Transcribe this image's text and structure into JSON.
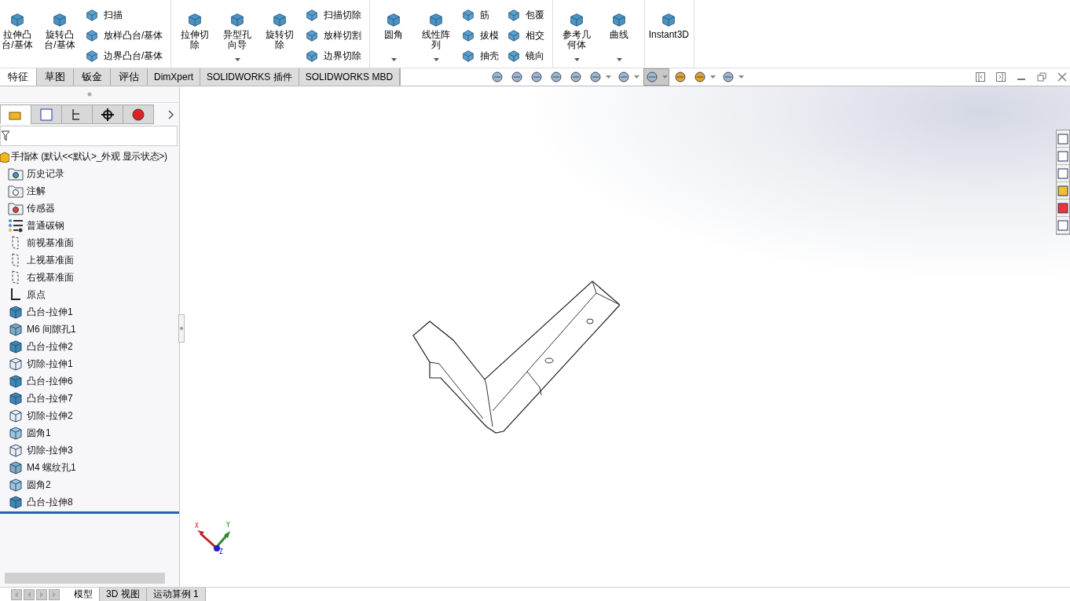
{
  "ribbon": {
    "groups": [
      {
        "items": [
          {
            "kind": "large",
            "label": "拉伸凸台/基体",
            "dropdown": false
          },
          {
            "kind": "large",
            "label": "旋转凸台/基体",
            "dropdown": false
          },
          {
            "kind": "stack",
            "entries": [
              "扫描",
              "放样凸台/基体",
              "边界凸台/基体"
            ]
          }
        ]
      },
      {
        "items": [
          {
            "kind": "large",
            "label": "拉伸切除",
            "dropdown": false
          },
          {
            "kind": "large",
            "label": "异型孔向导",
            "dropdown": true
          },
          {
            "kind": "large",
            "label": "旋转切除",
            "dropdown": false
          },
          {
            "kind": "stack",
            "entries": [
              "扫描切除",
              "放样切割",
              "边界切除"
            ]
          }
        ]
      },
      {
        "items": [
          {
            "kind": "large",
            "label": "圆角",
            "dropdown": true
          },
          {
            "kind": "large",
            "label": "线性阵列",
            "dropdown": true
          },
          {
            "kind": "stack",
            "entries": [
              "筋",
              "拔模",
              "抽壳"
            ]
          },
          {
            "kind": "stack",
            "entries": [
              "包覆",
              "相交",
              "镜向"
            ]
          }
        ]
      },
      {
        "items": [
          {
            "kind": "large",
            "label": "参考几何体",
            "dropdown": true
          },
          {
            "kind": "large",
            "label": "曲线",
            "dropdown": true
          }
        ]
      },
      {
        "items": [
          {
            "kind": "large",
            "label": "Instant3D",
            "dropdown": false
          }
        ]
      }
    ]
  },
  "tabs": [
    {
      "label": "特征",
      "selected": true
    },
    {
      "label": "草图",
      "selected": false
    },
    {
      "label": "钣金",
      "selected": false
    },
    {
      "label": "评估",
      "selected": false
    },
    {
      "label": "DimXpert",
      "selected": false
    },
    {
      "label": "SOLIDWORKS 插件",
      "selected": false
    },
    {
      "label": "SOLIDWORKS MBD",
      "selected": false
    }
  ],
  "view_toolbar": [
    {
      "dropdown": false,
      "pressed": false
    },
    {
      "dropdown": false,
      "pressed": false
    },
    {
      "dropdown": false,
      "pressed": false
    },
    {
      "dropdown": false,
      "pressed": false
    },
    {
      "dropdown": false,
      "pressed": false
    },
    {
      "dropdown": true,
      "pressed": false
    },
    {
      "dropdown": true,
      "pressed": false
    },
    {
      "dropdown": true,
      "pressed": true
    },
    {
      "dropdown": false,
      "pressed": false
    },
    {
      "dropdown": true,
      "pressed": false
    },
    {
      "dropdown": true,
      "pressed": false
    }
  ],
  "panel_tabs": [
    {
      "selected": true
    },
    {
      "selected": false
    },
    {
      "selected": false
    },
    {
      "selected": false
    },
    {
      "selected": false
    }
  ],
  "tree": {
    "label": "手指体 (默认<<默认>_外观 显示状态>)",
    "children": [
      {
        "kind": "history",
        "label": "历史记录"
      },
      {
        "kind": "annotations",
        "label": "注解"
      },
      {
        "kind": "sensors",
        "label": "传感器"
      },
      {
        "kind": "material",
        "label": "普通碳钢"
      },
      {
        "kind": "plane",
        "label": "前视基准面"
      },
      {
        "kind": "plane",
        "label": "上视基准面"
      },
      {
        "kind": "plane",
        "label": "右视基准面"
      },
      {
        "kind": "origin",
        "label": "原点"
      },
      {
        "kind": "boss",
        "label": "凸台-拉伸1"
      },
      {
        "kind": "hole",
        "label": "M6 间隙孔1"
      },
      {
        "kind": "boss",
        "label": "凸台-拉伸2"
      },
      {
        "kind": "cut",
        "label": "切除-拉伸1"
      },
      {
        "kind": "boss",
        "label": "凸台-拉伸6"
      },
      {
        "kind": "boss",
        "label": "凸台-拉伸7"
      },
      {
        "kind": "cut",
        "label": "切除-拉伸2"
      },
      {
        "kind": "fillet",
        "label": "圆角1"
      },
      {
        "kind": "cut",
        "label": "切除-拉伸3"
      },
      {
        "kind": "hole",
        "label": "M4 螺纹孔1"
      },
      {
        "kind": "fillet",
        "label": "圆角2"
      },
      {
        "kind": "boss",
        "label": "凸台-拉伸8"
      }
    ]
  },
  "triad": {
    "x": "X",
    "y": "Y",
    "z": "Z"
  },
  "bottom_tabs": [
    {
      "label": "模型",
      "selected": true
    },
    {
      "label": "3D 视图",
      "selected": false
    },
    {
      "label": "运动算例 1",
      "selected": false
    }
  ]
}
